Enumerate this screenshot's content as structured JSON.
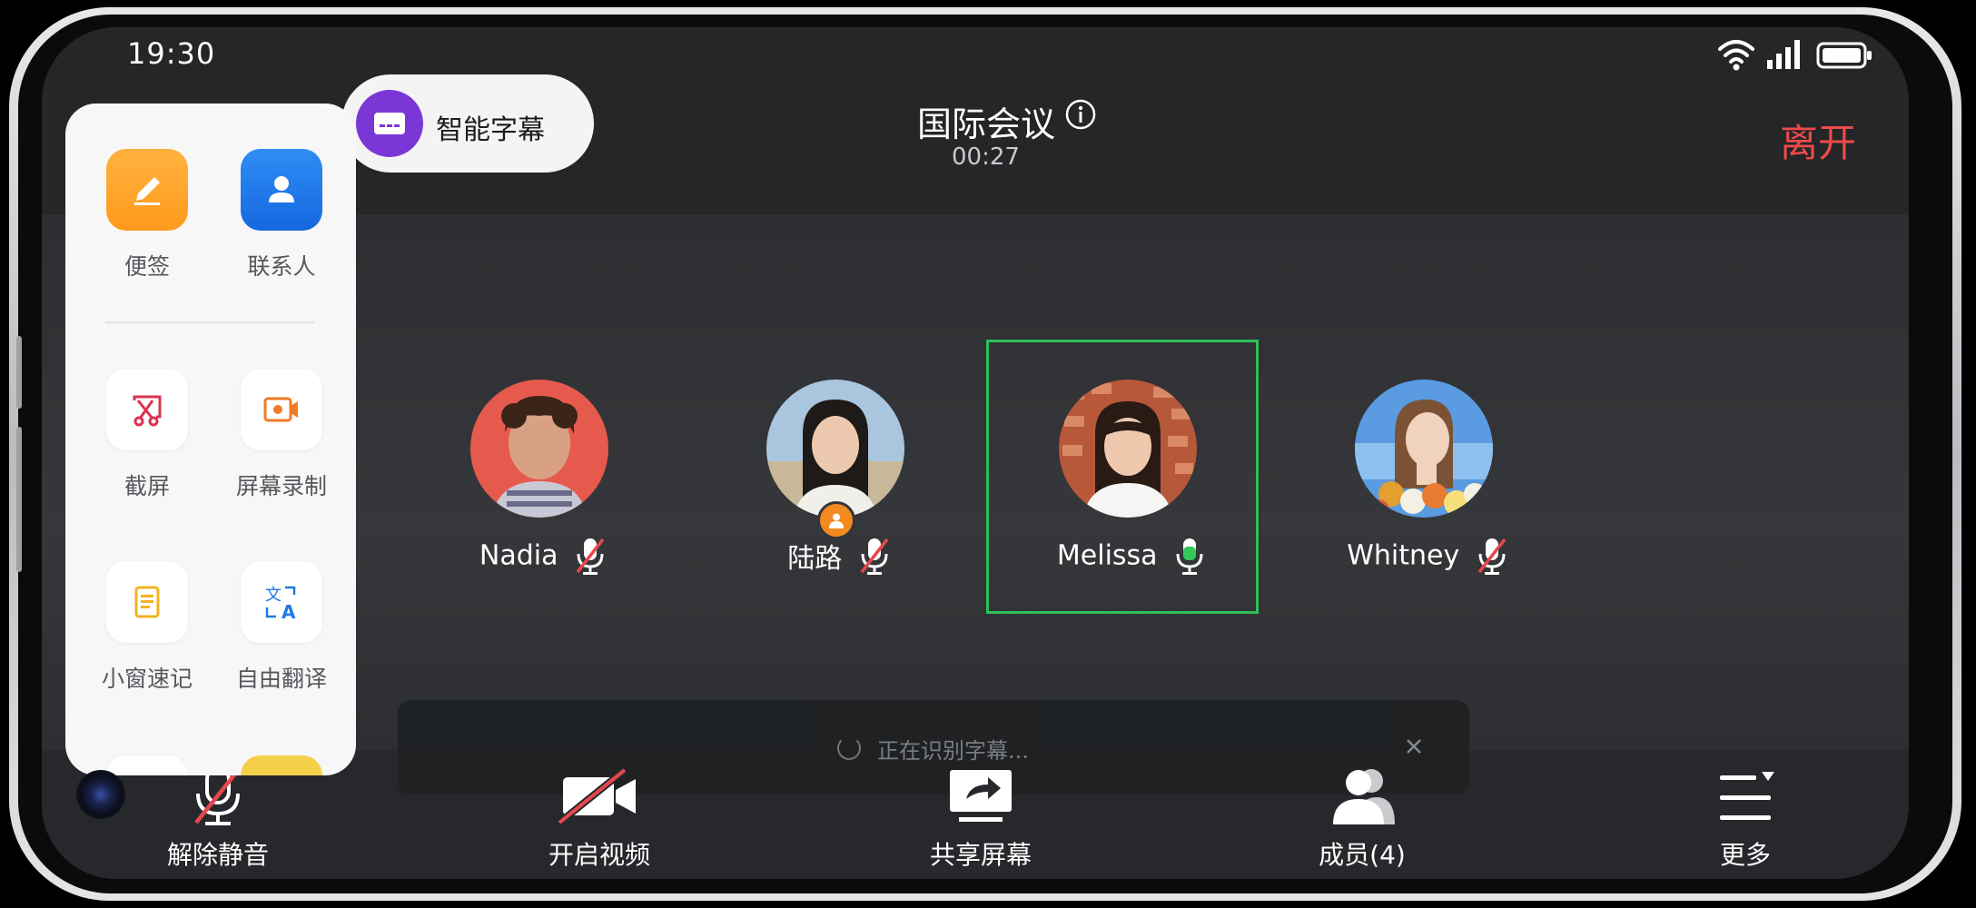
{
  "status_bar": {
    "time": "19:30"
  },
  "header": {
    "caption_button_label": "智能字幕",
    "meeting_title": "国际会议",
    "elapsed": "00:27",
    "leave_label": "离开"
  },
  "participants": [
    {
      "name": "Nadia",
      "mic": "muted"
    },
    {
      "name": "陆路",
      "mic": "muted",
      "host": true
    },
    {
      "name": "Melissa",
      "mic": "speaking",
      "active": true
    },
    {
      "name": "Whitney",
      "mic": "muted"
    }
  ],
  "caption_overlay": {
    "status_text": "正在识别字幕..."
  },
  "bottom_bar": {
    "unmute_label": "解除静音",
    "video_label": "开启视频",
    "share_label": "共享屏幕",
    "members_label": "成员(4)",
    "more_label": "更多"
  },
  "side_panel": {
    "notes_label": "便签",
    "contacts_label": "联系人",
    "screenshot_label": "截屏",
    "record_label": "屏幕录制",
    "quicknote_label": "小窗速记",
    "translate_label": "自由翻译"
  },
  "colors": {
    "accent_purple": "#7b37d6",
    "leave_red": "#f04a4a",
    "active_green": "#2fbf5a",
    "mute_red": "#e5484d"
  }
}
